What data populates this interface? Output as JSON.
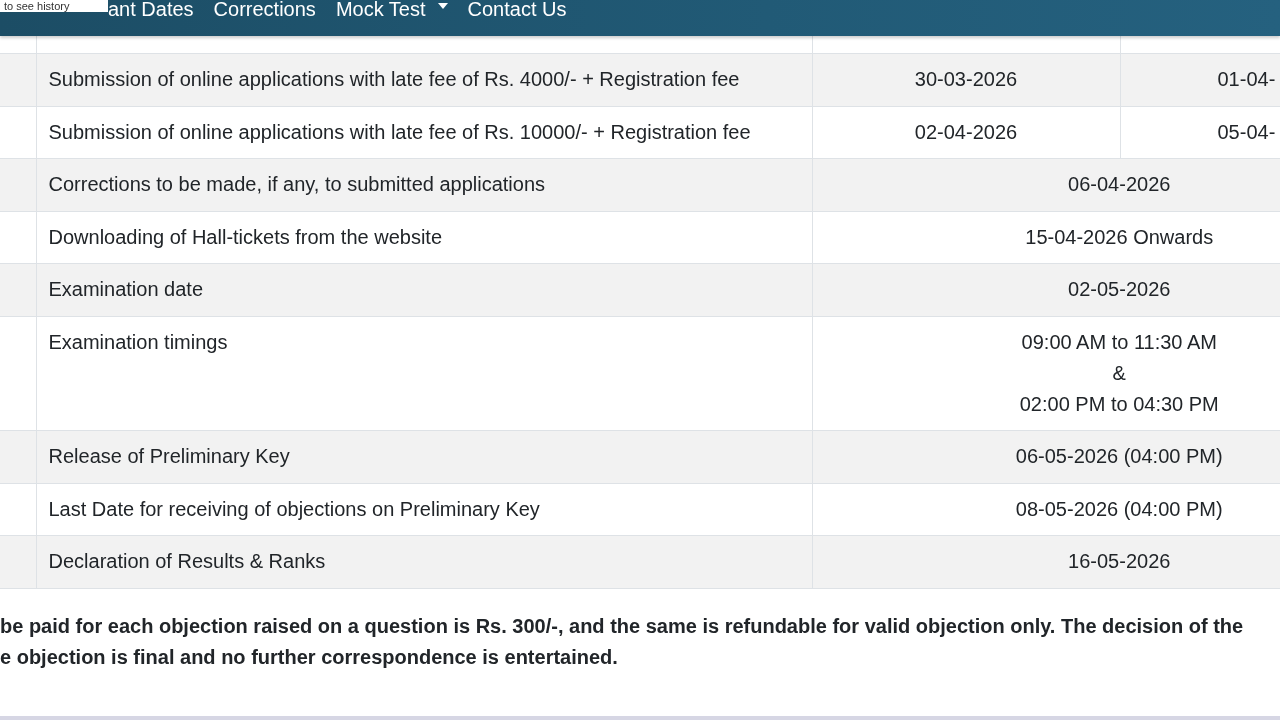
{
  "tooltip": {
    "text": "to see history"
  },
  "nav": {
    "items": [
      {
        "label": "ant Dates",
        "dropdown": false
      },
      {
        "label": "Corrections",
        "dropdown": false
      },
      {
        "label": "Mock Test",
        "dropdown": true
      },
      {
        "label": "Contact Us",
        "dropdown": false
      }
    ]
  },
  "schedule_table": {
    "rows": [
      {
        "event": "Submission of online applications with late fee of Rs. 4000/- + Registration fee",
        "dates": [
          "30-03-2026",
          "01-04-"
        ]
      },
      {
        "event": "Submission of online applications with late fee of Rs. 10000/- + Registration fee",
        "dates": [
          "02-04-2026",
          "05-04-"
        ]
      },
      {
        "event": "Corrections to be made, if any, to submitted applications",
        "dates": [
          "06-04-2026"
        ]
      },
      {
        "event": "Downloading of Hall-tickets from the website",
        "dates": [
          "15-04-2026 Onwards"
        ]
      },
      {
        "event": "Examination date",
        "dates": [
          "02-05-2026"
        ]
      },
      {
        "event": "Examination timings",
        "dates": [
          "09:00 AM to 11:30 AM\n&\n02:00 PM to 04:30 PM"
        ]
      },
      {
        "event": "Release of Preliminary Key",
        "dates": [
          "06-05-2026 (04:00 PM)"
        ]
      },
      {
        "event": "Last Date for receiving of objections on Preliminary Key",
        "dates": [
          "08-05-2026 (04:00 PM)"
        ]
      },
      {
        "event": "Declaration of Results & Ranks",
        "dates": [
          "16-05-2026"
        ]
      }
    ]
  },
  "note": {
    "text": "be paid for each objection raised on a question is Rs. 300/-, and the same is refundable for valid objection only. The decision of the\ne objection is final and no further correspondence is entertained."
  }
}
